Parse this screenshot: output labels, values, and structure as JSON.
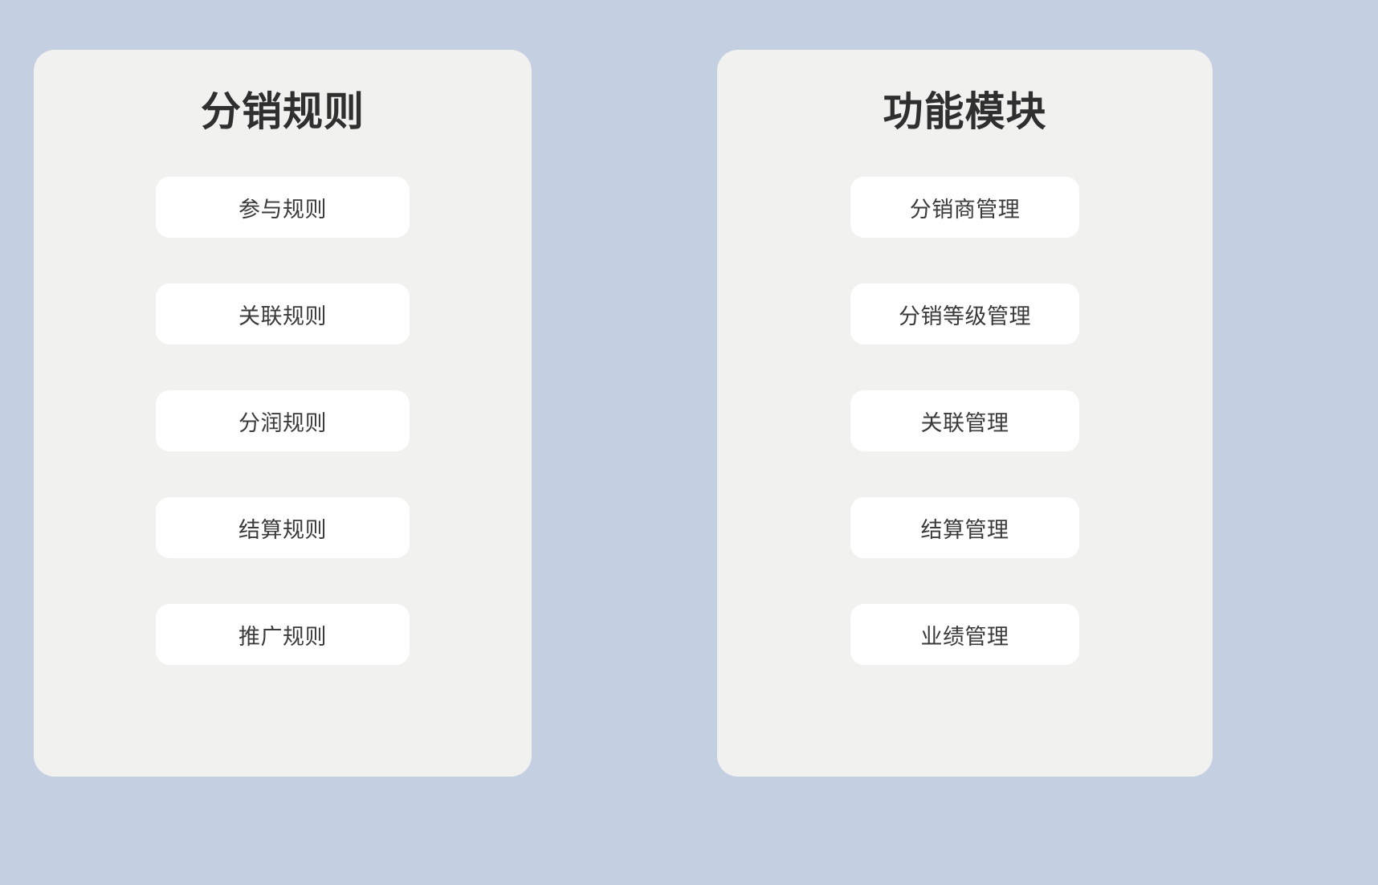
{
  "theme": {
    "background_color": "#c5cfe2",
    "panel_color": "#f1f1f0",
    "pill_color": "#ffffff",
    "title_color": "#2f2f2f",
    "item_text_color": "#3a3a3a"
  },
  "panels": [
    {
      "title": "分销规则",
      "items": [
        {
          "label": "参与规则"
        },
        {
          "label": "关联规则"
        },
        {
          "label": "分润规则"
        },
        {
          "label": "结算规则"
        },
        {
          "label": "推广规则"
        }
      ]
    },
    {
      "title": "功能模块",
      "items": [
        {
          "label": "分销商管理"
        },
        {
          "label": "分销等级管理"
        },
        {
          "label": "关联管理"
        },
        {
          "label": "结算管理"
        },
        {
          "label": "业绩管理"
        }
      ]
    }
  ]
}
